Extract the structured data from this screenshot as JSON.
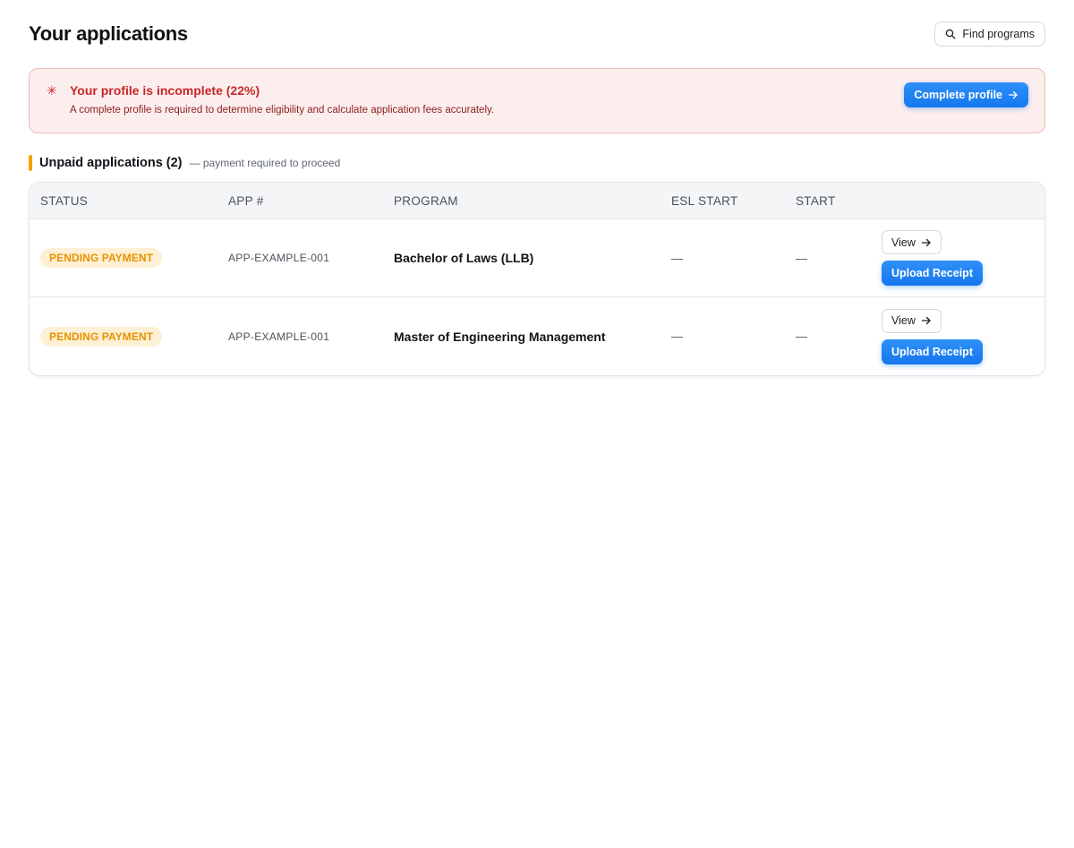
{
  "header": {
    "title": "Your applications",
    "find_programs_label": "Find programs"
  },
  "alert": {
    "title": "Your profile is incomplete (22%)",
    "text": "A complete profile is required to determine eligibility and calculate application fees accurately.",
    "button_label": "Complete profile",
    "icon": "asterisk-icon"
  },
  "section": {
    "title": "Unpaid applications (2)",
    "subtitle": "— payment required to proceed"
  },
  "table": {
    "columns": [
      "STATUS",
      "APP #",
      "PROGRAM",
      "ESL START",
      "START"
    ],
    "rows": [
      {
        "status": "PENDING PAYMENT",
        "app_no": "APP-EXAMPLE-001",
        "program": "Bachelor of Laws (LLB)",
        "esl_start": "—",
        "start": "—",
        "view_label": "View",
        "upload_label": "Upload Receipt"
      },
      {
        "status": "PENDING PAYMENT",
        "app_no": "APP-EXAMPLE-001",
        "program": "Master of Engineering Management",
        "esl_start": "—",
        "start": "—",
        "view_label": "View",
        "upload_label": "Upload Receipt"
      }
    ]
  },
  "colors": {
    "accent": "#1677ee",
    "alert_bg": "#fdeeee",
    "alert_text": "#c62828",
    "badge_bg": "#fdf0d4",
    "badge_text": "#e89200",
    "section_bar": "#f3a000"
  }
}
